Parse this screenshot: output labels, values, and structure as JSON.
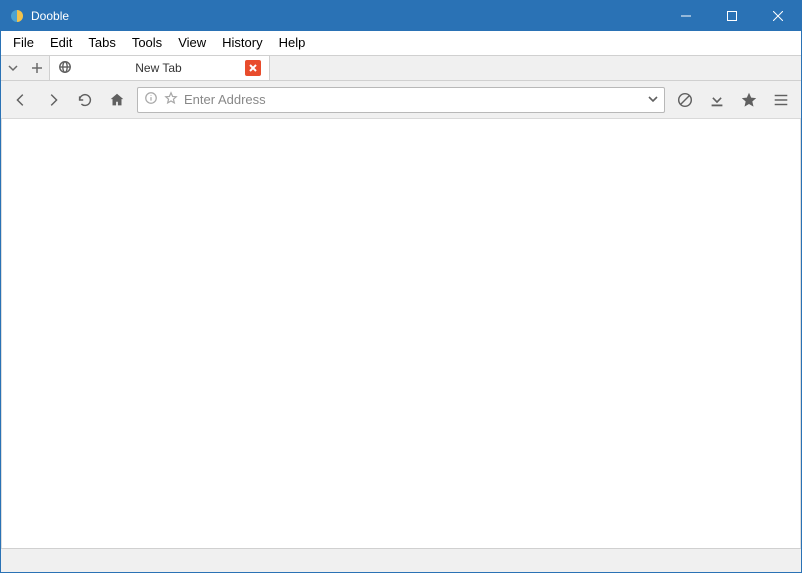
{
  "titlebar": {
    "title": "Dooble"
  },
  "menubar": {
    "items": [
      "File",
      "Edit",
      "Tabs",
      "Tools",
      "View",
      "History",
      "Help"
    ]
  },
  "tabs": [
    {
      "label": "New Tab"
    }
  ],
  "addressbar": {
    "placeholder": "Enter Address",
    "value": ""
  }
}
